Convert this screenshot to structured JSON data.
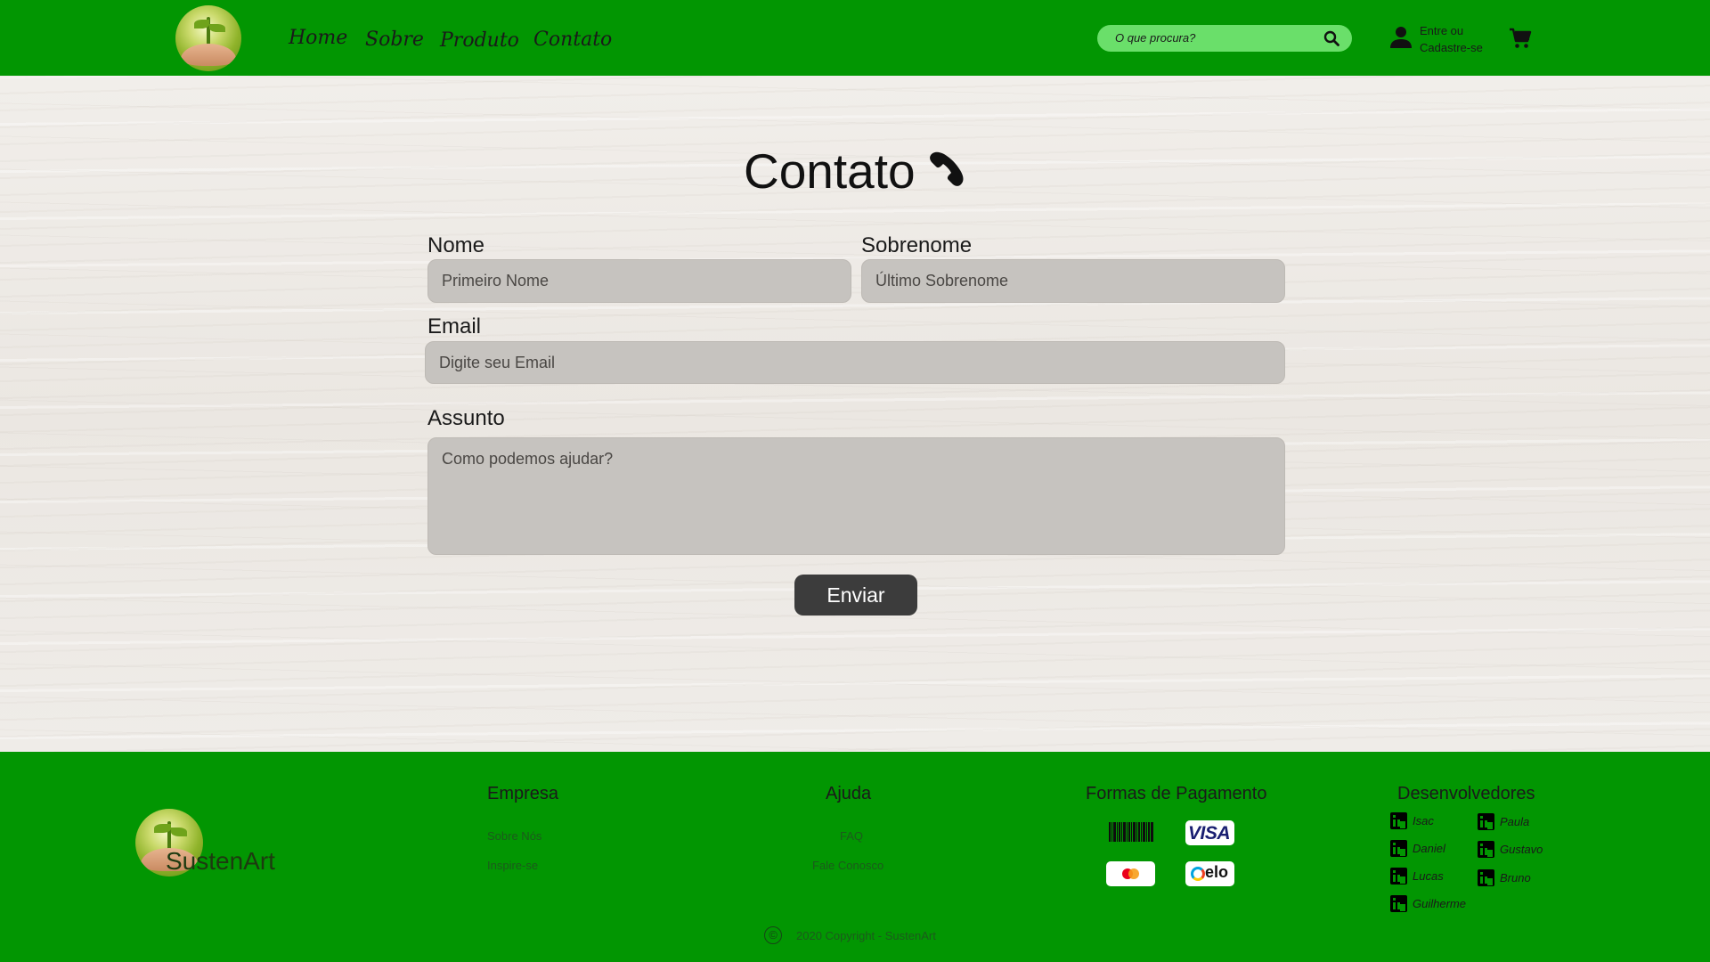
{
  "header": {
    "nav": [
      "Home",
      "Sobre",
      "Produto",
      "Contato"
    ],
    "search_placeholder": "O que procura?",
    "login_line1": "Entre ou",
    "login_line2": "Cadastre-se"
  },
  "form": {
    "title": "Contato",
    "nome_label": "Nome",
    "nome_placeholder": "Primeiro Nome",
    "sobrenome_label": "Sobrenome",
    "sobrenome_placeholder": "Último Sobrenome",
    "email_label": "Email",
    "email_placeholder": "Digite seu Email",
    "assunto_label": "Assunto",
    "assunto_placeholder": "Como podemos ajudar?",
    "submit": "Enviar"
  },
  "footer": {
    "brand": "SustenArt",
    "empresa": {
      "title": "Empresa",
      "links": [
        "Sobre Nós",
        "Inspire-se"
      ]
    },
    "ajuda": {
      "title": "Ajuda",
      "links": [
        "FAQ",
        "Fale Conosco"
      ]
    },
    "pagamento": {
      "title": "Formas de Pagamento",
      "methods": [
        "boleto-icon",
        "visa-icon",
        "mastercard-icon",
        "elo-icon"
      ],
      "visa_text": "VISA",
      "elo_text": "elo"
    },
    "desenvolvedores": {
      "title": "Desenvolvedores",
      "names": [
        "Isac",
        "Paula",
        "Daniel",
        "Gustavo",
        "Lucas",
        "Bruno",
        "Guilherme"
      ]
    },
    "copyright": "2020 Copyright - SustenArt"
  },
  "colors": {
    "brand_green": "#029602",
    "search_green": "#6adf6a",
    "button_dark": "#3c3c3c",
    "field_gray": "#c6c3bf"
  }
}
